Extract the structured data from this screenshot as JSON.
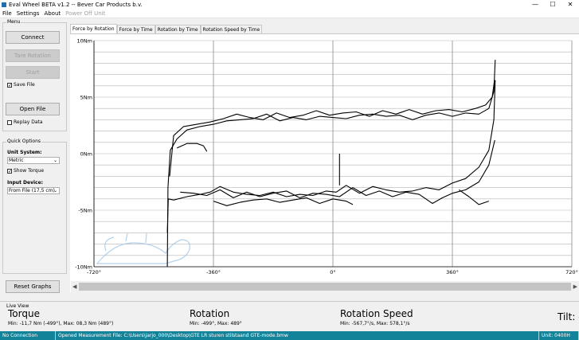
{
  "window": {
    "title": "Eval Wheel BETA v1.2 -- Bever Car Products b.v.",
    "minimize": "—",
    "maximize": "☐",
    "close": "✕"
  },
  "menu": {
    "file": "File",
    "settings": "Settings",
    "about": "About",
    "power_off": "Power Off Unit"
  },
  "sidebar": {
    "menu_group": "Menu",
    "connect": "Connect",
    "tare_rotation": "Tare Rotation",
    "start": "Start",
    "save_file": "Save File",
    "save_file_checked": true,
    "open_file": "Open File",
    "replay_data": "Replay Data",
    "replay_data_checked": false,
    "quick_options": "Quick Options",
    "unit_system_label": "Unit System:",
    "unit_system_value": "Metric",
    "show_torque": "Show Torque",
    "show_torque_checked": true,
    "input_device_label": "Input Device:",
    "input_device_value": "From File (17,5 cm)",
    "reset_graphs": "Reset Graphs"
  },
  "tabs": [
    {
      "label": "Force by Rotation",
      "active": true
    },
    {
      "label": "Force by Time",
      "active": false
    },
    {
      "label": "Rotation by Time",
      "active": false
    },
    {
      "label": "Rotation Speed by Time",
      "active": false
    }
  ],
  "chart_data": {
    "type": "line",
    "xlabel": "",
    "ylabel": "",
    "xlim": [
      -720,
      720
    ],
    "ylim": [
      -10,
      10
    ],
    "x_ticks": [
      "-720°",
      "-360°",
      "0°",
      "360°",
      "720°"
    ],
    "y_ticks": [
      "10Nm",
      "5Nm",
      "0Nm",
      "-5Nm",
      "-10Nm"
    ],
    "grid": true,
    "series": [
      {
        "values": [
          [
            -499,
            -10
          ],
          [
            -497,
            -3
          ],
          [
            -490,
            0.3
          ],
          [
            -470,
            1.3
          ],
          [
            -440,
            2.1
          ],
          [
            -400,
            2.4
          ],
          [
            -360,
            2.6
          ],
          [
            -320,
            2.9
          ],
          [
            -280,
            3.0
          ],
          [
            -240,
            3.1
          ],
          [
            -200,
            3.5
          ],
          [
            -160,
            2.9
          ],
          [
            -120,
            3.2
          ],
          [
            -80,
            3.0
          ],
          [
            -40,
            3.3
          ],
          [
            0,
            3.2
          ],
          [
            40,
            3.1
          ],
          [
            80,
            3.4
          ],
          [
            120,
            3.5
          ],
          [
            160,
            3.3
          ],
          [
            200,
            3.4
          ],
          [
            240,
            3.0
          ],
          [
            280,
            3.4
          ],
          [
            320,
            3.6
          ],
          [
            360,
            3.3
          ],
          [
            400,
            3.6
          ],
          [
            440,
            3.5
          ],
          [
            470,
            4.0
          ],
          [
            485,
            5.5
          ],
          [
            489,
            8.3
          ]
        ]
      },
      {
        "values": [
          [
            -492,
            -2
          ],
          [
            -480,
            1.6
          ],
          [
            -450,
            2.4
          ],
          [
            -410,
            2.6
          ],
          [
            -370,
            2.8
          ],
          [
            -330,
            3.1
          ],
          [
            -290,
            3.5
          ],
          [
            -250,
            3.2
          ],
          [
            -210,
            3.0
          ],
          [
            -170,
            3.6
          ],
          [
            -130,
            3.2
          ],
          [
            -90,
            3.4
          ],
          [
            -50,
            3.8
          ],
          [
            -10,
            3.4
          ],
          [
            30,
            3.6
          ],
          [
            70,
            3.7
          ],
          [
            110,
            3.3
          ],
          [
            150,
            3.8
          ],
          [
            190,
            3.5
          ],
          [
            230,
            3.9
          ],
          [
            270,
            3.5
          ],
          [
            310,
            3.8
          ],
          [
            350,
            3.9
          ],
          [
            390,
            3.7
          ],
          [
            430,
            4.0
          ],
          [
            460,
            4.3
          ],
          [
            480,
            5.0
          ],
          [
            487,
            6.5
          ]
        ]
      },
      {
        "values": [
          [
            -470,
            0.5
          ],
          [
            -440,
            0.9
          ],
          [
            -410,
            0.9
          ],
          [
            -390,
            0.7
          ],
          [
            -380,
            0.2
          ]
        ]
      },
      {
        "values": [
          [
            -499,
            -7
          ],
          [
            -496,
            -4
          ],
          [
            -480,
            -4.1
          ],
          [
            -440,
            -3.8
          ],
          [
            -400,
            -3.6
          ],
          [
            -370,
            -3.4
          ],
          [
            -340,
            -2.9
          ],
          [
            -300,
            -3.4
          ],
          [
            -260,
            -3.6
          ],
          [
            -220,
            -3.7
          ],
          [
            -180,
            -3.4
          ],
          [
            -140,
            -3.8
          ],
          [
            -100,
            -3.6
          ],
          [
            -60,
            -3.7
          ],
          [
            -20,
            -3.3
          ],
          [
            10,
            -3.4
          ],
          [
            40,
            -2.8
          ],
          [
            80,
            -3.5
          ],
          [
            120,
            -2.9
          ],
          [
            160,
            -3.2
          ],
          [
            200,
            -3.4
          ],
          [
            240,
            -3.3
          ],
          [
            280,
            -3.0
          ],
          [
            320,
            -3.2
          ],
          [
            360,
            -2.6
          ],
          [
            400,
            -2.2
          ],
          [
            440,
            -1.2
          ],
          [
            470,
            0.3
          ],
          [
            485,
            3.0
          ],
          [
            489,
            6.5
          ]
        ]
      },
      {
        "values": [
          [
            -460,
            -3.4
          ],
          [
            -420,
            -3.5
          ],
          [
            -380,
            -3.7
          ],
          [
            -340,
            -3.2
          ],
          [
            -300,
            -3.9
          ],
          [
            -260,
            -3.4
          ],
          [
            -220,
            -3.8
          ],
          [
            -180,
            -3.5
          ],
          [
            -140,
            -3.3
          ],
          [
            -100,
            -3.9
          ],
          [
            -60,
            -3.5
          ],
          [
            -20,
            -3.6
          ],
          [
            20,
            -3.8
          ],
          [
            60,
            -3.0
          ],
          [
            100,
            -3.7
          ],
          [
            140,
            -3.3
          ],
          [
            180,
            -3.8
          ],
          [
            220,
            -3.4
          ],
          [
            260,
            -3.6
          ],
          [
            300,
            -4.4
          ],
          [
            330,
            -3.9
          ],
          [
            360,
            -3.5
          ],
          [
            400,
            -3.2
          ],
          [
            440,
            -2.5
          ],
          [
            470,
            -1.0
          ],
          [
            488,
            1.2
          ]
        ]
      },
      {
        "values": [
          [
            380,
            -3.2
          ],
          [
            410,
            -3.8
          ],
          [
            440,
            -4.5
          ],
          [
            470,
            -4.2
          ]
        ]
      },
      {
        "values": [
          [
            -360,
            -4.2
          ],
          [
            -320,
            -4.6
          ],
          [
            -280,
            -4.3
          ],
          [
            -240,
            -4.1
          ],
          [
            -200,
            -4.0
          ],
          [
            -160,
            -4.3
          ],
          [
            -120,
            -4.1
          ],
          [
            -80,
            -3.9
          ],
          [
            -40,
            -4.4
          ],
          [
            0,
            -4.0
          ],
          [
            40,
            -4.2
          ],
          [
            60,
            -4.5
          ]
        ]
      },
      {
        "values": [
          [
            20,
            -2.8
          ],
          [
            20,
            0
          ]
        ]
      }
    ]
  },
  "scroll": {
    "left_arrow": "◀",
    "right_arrow": "▶"
  },
  "live_view": {
    "title": "Live View",
    "torque_label": "Torque",
    "torque_stats": "Min: -11,7 Nm (-499°), Max: 08,3 Nm (489°)",
    "rotation_label": "Rotation",
    "rotation_stats": "Min: -499°, Max: 489°",
    "speed_label": "Rotation Speed",
    "speed_stats": "Min: -567,7°/s, Max: 578,1°/s",
    "tilt_label": "Tilt: -"
  },
  "status": {
    "connection": "No Connection",
    "file": "Opened Measurement File: C:\\Users\\jarjo_000\\Desktop\\GTE LR sturen stilstaand GTE-mode.bmw",
    "unit": "Unit: 0400H"
  }
}
